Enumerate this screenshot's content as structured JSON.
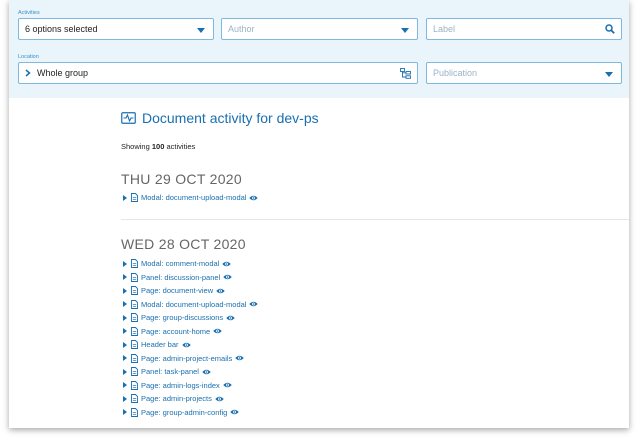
{
  "filters": {
    "activities_label": "Activities",
    "activities_value": "6 options selected",
    "author_placeholder": "Author",
    "label_placeholder": "Label",
    "location_label": "Location",
    "location_value": "Whole group",
    "publication_placeholder": "Publication"
  },
  "main": {
    "title": "Document activity for dev-ps",
    "showing_prefix": "Showing",
    "showing_count": "100",
    "showing_suffix": "activities",
    "days": [
      {
        "date": "THU 29 OCT 2020",
        "items": [
          "Modal: document-upload-modal"
        ]
      },
      {
        "date": "WED 28 OCT 2020",
        "items": [
          "Modal: comment-modal",
          "Panel: discussion-panel",
          "Page: document-view",
          "Modal: document-upload-modal",
          "Page: group-discussions",
          "Page: account-home",
          "Header bar",
          "Page: admin-project-emails",
          "Panel: task-panel",
          "Page: admin-logs-index",
          "Page: admin-projects",
          "Page: group-admin-config"
        ]
      }
    ]
  },
  "icons": {
    "activity": "activity-icon",
    "search": "search-icon",
    "tree": "tree-icon",
    "document": "document-icon",
    "eye": "eye-icon",
    "expand": "expand-triangle-icon"
  },
  "colors": {
    "accent": "#1a6fb0",
    "filter_bg": "#e9f4fb",
    "field_border": "#7fb9e0"
  }
}
